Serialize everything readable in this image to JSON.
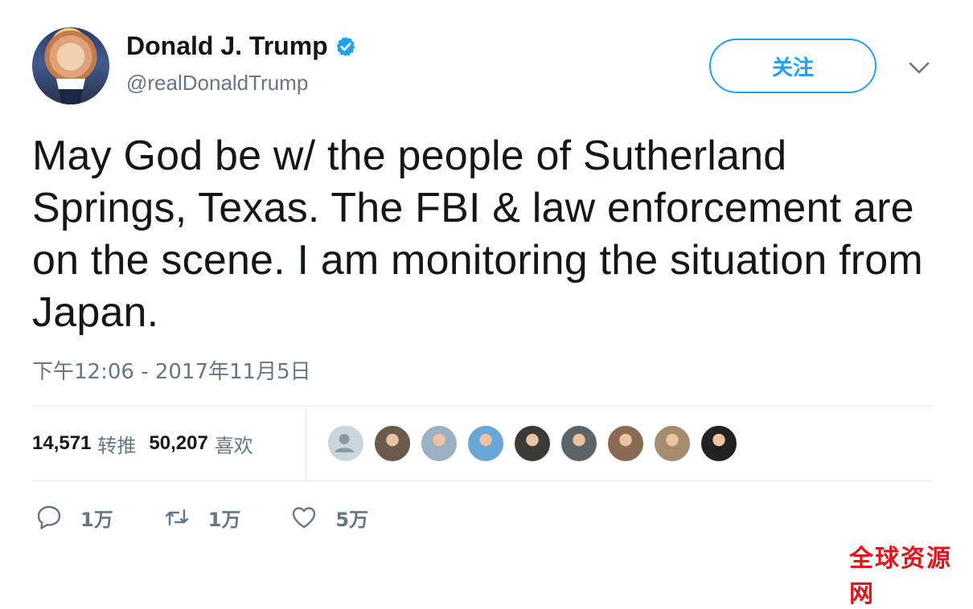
{
  "user": {
    "name": "Donald J. Trump",
    "handle": "@realDonaldTrump",
    "verified": true,
    "follow_label": "关注"
  },
  "tweet": {
    "text": "May God be w/ the people of Sutherland Springs, Texas. The FBI & law enforcement are on the scene. I am monitoring the situation from Japan.",
    "timestamp": "下午12:06 - 2017年11月5日"
  },
  "stats": {
    "retweets_count": "14,571",
    "retweets_label": "转推",
    "likes_count": "50,207",
    "likes_label": "喜欢"
  },
  "liker_avatars": [
    {
      "name": "default-avatar",
      "color": "#ccd6dd"
    },
    {
      "name": "user-avatar-2",
      "color": "#6b5a4a"
    },
    {
      "name": "user-avatar-3",
      "color": "#9bb1c4"
    },
    {
      "name": "user-avatar-4",
      "color": "#6aa7d8"
    },
    {
      "name": "user-avatar-5",
      "color": "#3d3a35"
    },
    {
      "name": "user-avatar-6",
      "color": "#5c6468"
    },
    {
      "name": "user-avatar-7",
      "color": "#8a6a52"
    },
    {
      "name": "user-avatar-8",
      "color": "#a58c6f"
    },
    {
      "name": "user-avatar-9",
      "color": "#222222"
    }
  ],
  "actions": {
    "reply_count": "1万",
    "retweet_count": "1万",
    "like_count": "5万"
  },
  "watermark": "全球资源网",
  "colors": {
    "accent": "#1da1f2",
    "text": "#14171a",
    "secondary": "#657786",
    "divider": "#e6ecf0",
    "watermark": "#e0151a"
  }
}
